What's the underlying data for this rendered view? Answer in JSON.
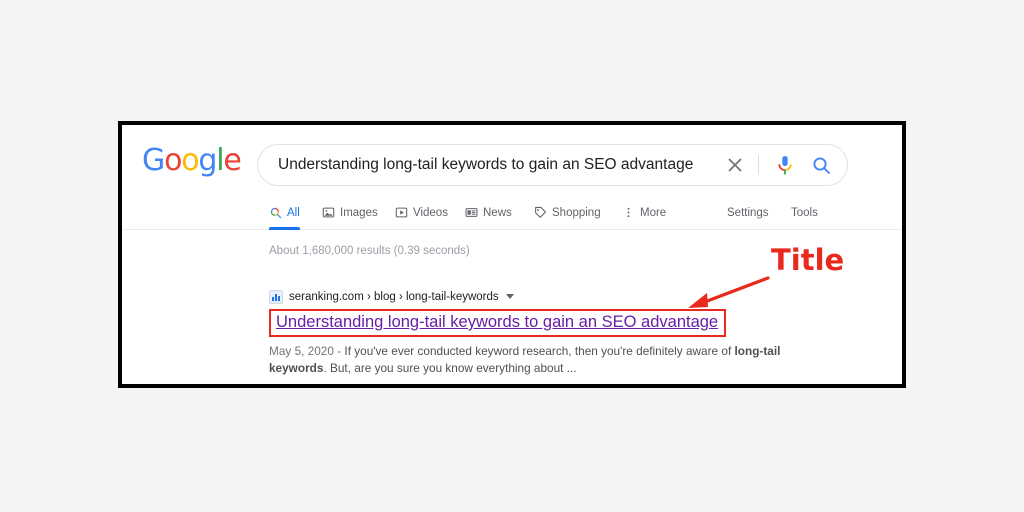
{
  "canvas": {
    "background_color": "#f4f4f4",
    "frame_border_color": "#000000"
  },
  "serp": {
    "logo": {
      "name": "Google",
      "letters": [
        {
          "char": "G",
          "color": "#4285F4"
        },
        {
          "char": "o",
          "color": "#EA4335"
        },
        {
          "char": "o",
          "color": "#FBBC05"
        },
        {
          "char": "g",
          "color": "#4285F4"
        },
        {
          "char": "l",
          "color": "#34A853"
        },
        {
          "char": "e",
          "color": "#EA4335"
        }
      ]
    },
    "search": {
      "value": "Understanding long-tail keywords to gain an SEO advantage",
      "placeholder": "Search",
      "clear_icon": "close-icon",
      "voice_icon": "microphone-icon",
      "submit_icon": "search-icon"
    },
    "tabs": [
      {
        "label": "All",
        "icon": "search-icon",
        "active": true
      },
      {
        "label": "Images",
        "icon": "image-icon",
        "active": false
      },
      {
        "label": "Videos",
        "icon": "video-icon",
        "active": false
      },
      {
        "label": "News",
        "icon": "newspaper-icon",
        "active": false
      },
      {
        "label": "Shopping",
        "icon": "tag-icon",
        "active": false
      },
      {
        "label": "More",
        "icon": "more-vertical-icon",
        "active": false
      }
    ],
    "tools": [
      {
        "label": "Settings"
      },
      {
        "label": "Tools"
      }
    ],
    "result_stats": "About 1,680,000 results (0.39 seconds)",
    "results": [
      {
        "favicon": "bar-chart-favicon",
        "url": "seranking.com › blog › long-tail-keywords",
        "url_caret": "chevron-down-icon",
        "title": "Understanding long-tail keywords to gain an SEO advantage",
        "title_color": "#681da8",
        "snippet_date": "May 5, 2020 - ",
        "snippet_part1": "If you've ever conducted keyword research, then you're definitely aware of ",
        "snippet_bold1": "long-tail keywords",
        "snippet_part2": ". But, are you sure you know everything about ..."
      }
    ]
  },
  "annotation": {
    "label": "Title",
    "color": "#e8291c",
    "arrow_icon": "arrow-pointer-icon",
    "highlight_box_color": "#e8291c"
  }
}
